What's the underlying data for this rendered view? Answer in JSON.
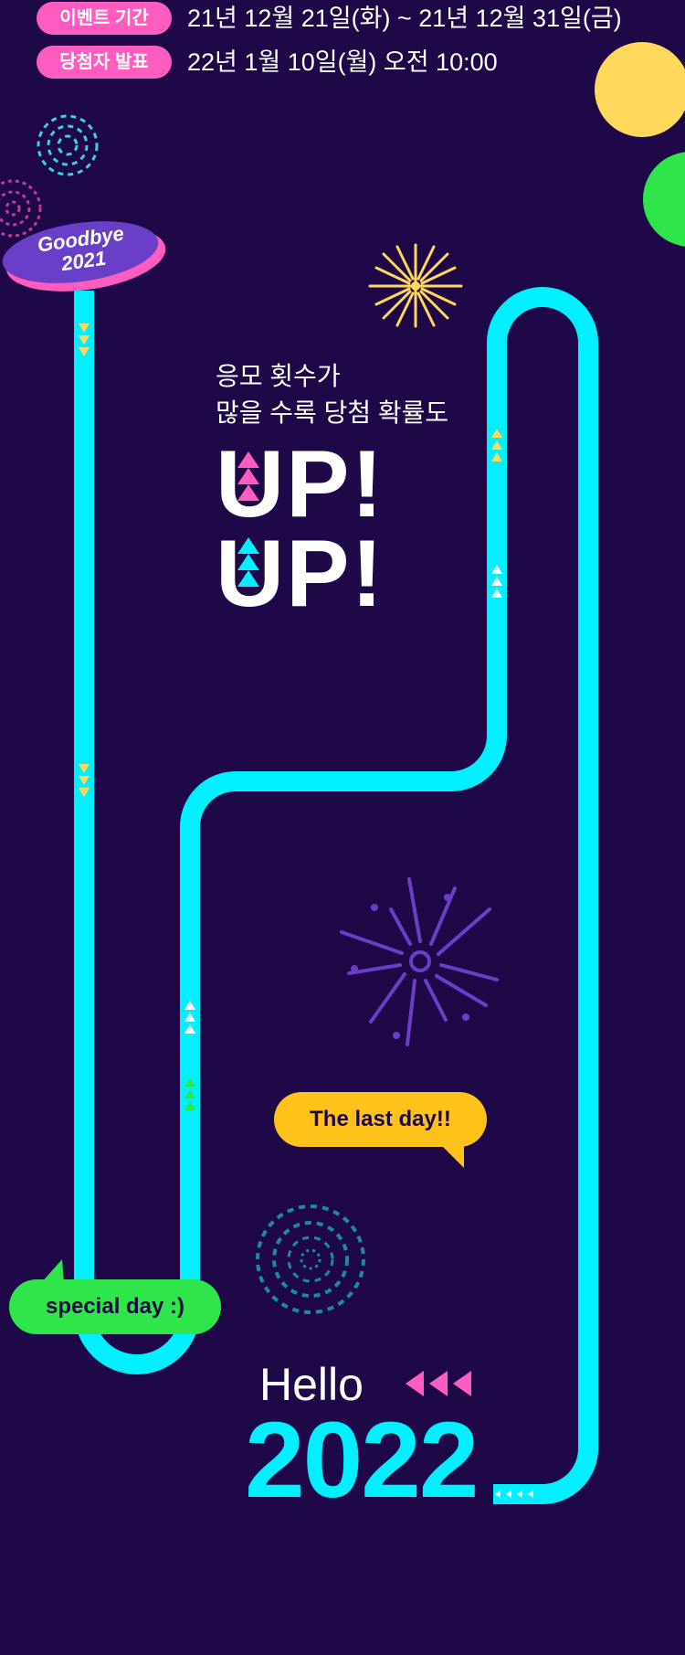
{
  "event": {
    "period_label": "이벤트 기간",
    "period_value": "21년 12월 21일(화) ~ 21년 12월 31일(금)",
    "announce_label": "당첨자 발표",
    "announce_value": "22년 1월 10일(월) 오전 10:00"
  },
  "goodbye_badge": {
    "line1": "Goodbye",
    "line2": "2021"
  },
  "headline": {
    "line1": "응모 횟수가",
    "line2": "많을 수록 당첨 확률도",
    "up1": "UP!",
    "up2": "UP!"
  },
  "bubbles": {
    "last_day": "The last day!!",
    "special_day": "special day :)"
  },
  "ending": {
    "hello": "Hello",
    "year": "2022"
  },
  "colors": {
    "background": "#1f0848",
    "track": "#00f0ff",
    "pink": "#ff5cbf",
    "yellow": "#ffd85c",
    "green": "#2ee64a",
    "purple": "#6a3fc7"
  },
  "icons": [
    "firework-teal-icon",
    "firework-pink-icon",
    "firework-yellow-icon",
    "firework-purple-icon",
    "firework-blue-icon",
    "arrow-triangles-icon"
  ]
}
